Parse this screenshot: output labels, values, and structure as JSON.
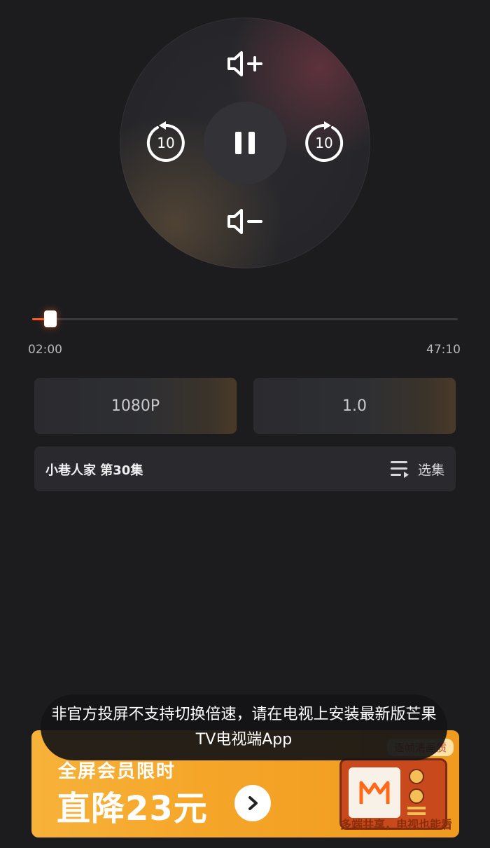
{
  "remote": {
    "volume_up_icon": "volume-up-icon",
    "volume_down_icon": "volume-down-icon",
    "pause_icon": "pause-icon",
    "rewind_seconds": "10",
    "forward_seconds": "10"
  },
  "progress": {
    "current_time": "02:00",
    "total_time": "47:10",
    "fraction": 0.042,
    "accent_color": "#ff5a1f"
  },
  "options": {
    "resolution": "1080P",
    "speed": "1.0"
  },
  "episode": {
    "title": "小巷人家 第30集",
    "select_label": "选集"
  },
  "ad": {
    "tag": "逐帧清画质",
    "subtitle": "全屏会员限时",
    "headline": "直降23元",
    "slogan": "多端共享，电视也能看"
  },
  "toast": {
    "message": "非官方投屏不支持切换倍速，请在电视上安装最新版芒果TV电视端App"
  }
}
